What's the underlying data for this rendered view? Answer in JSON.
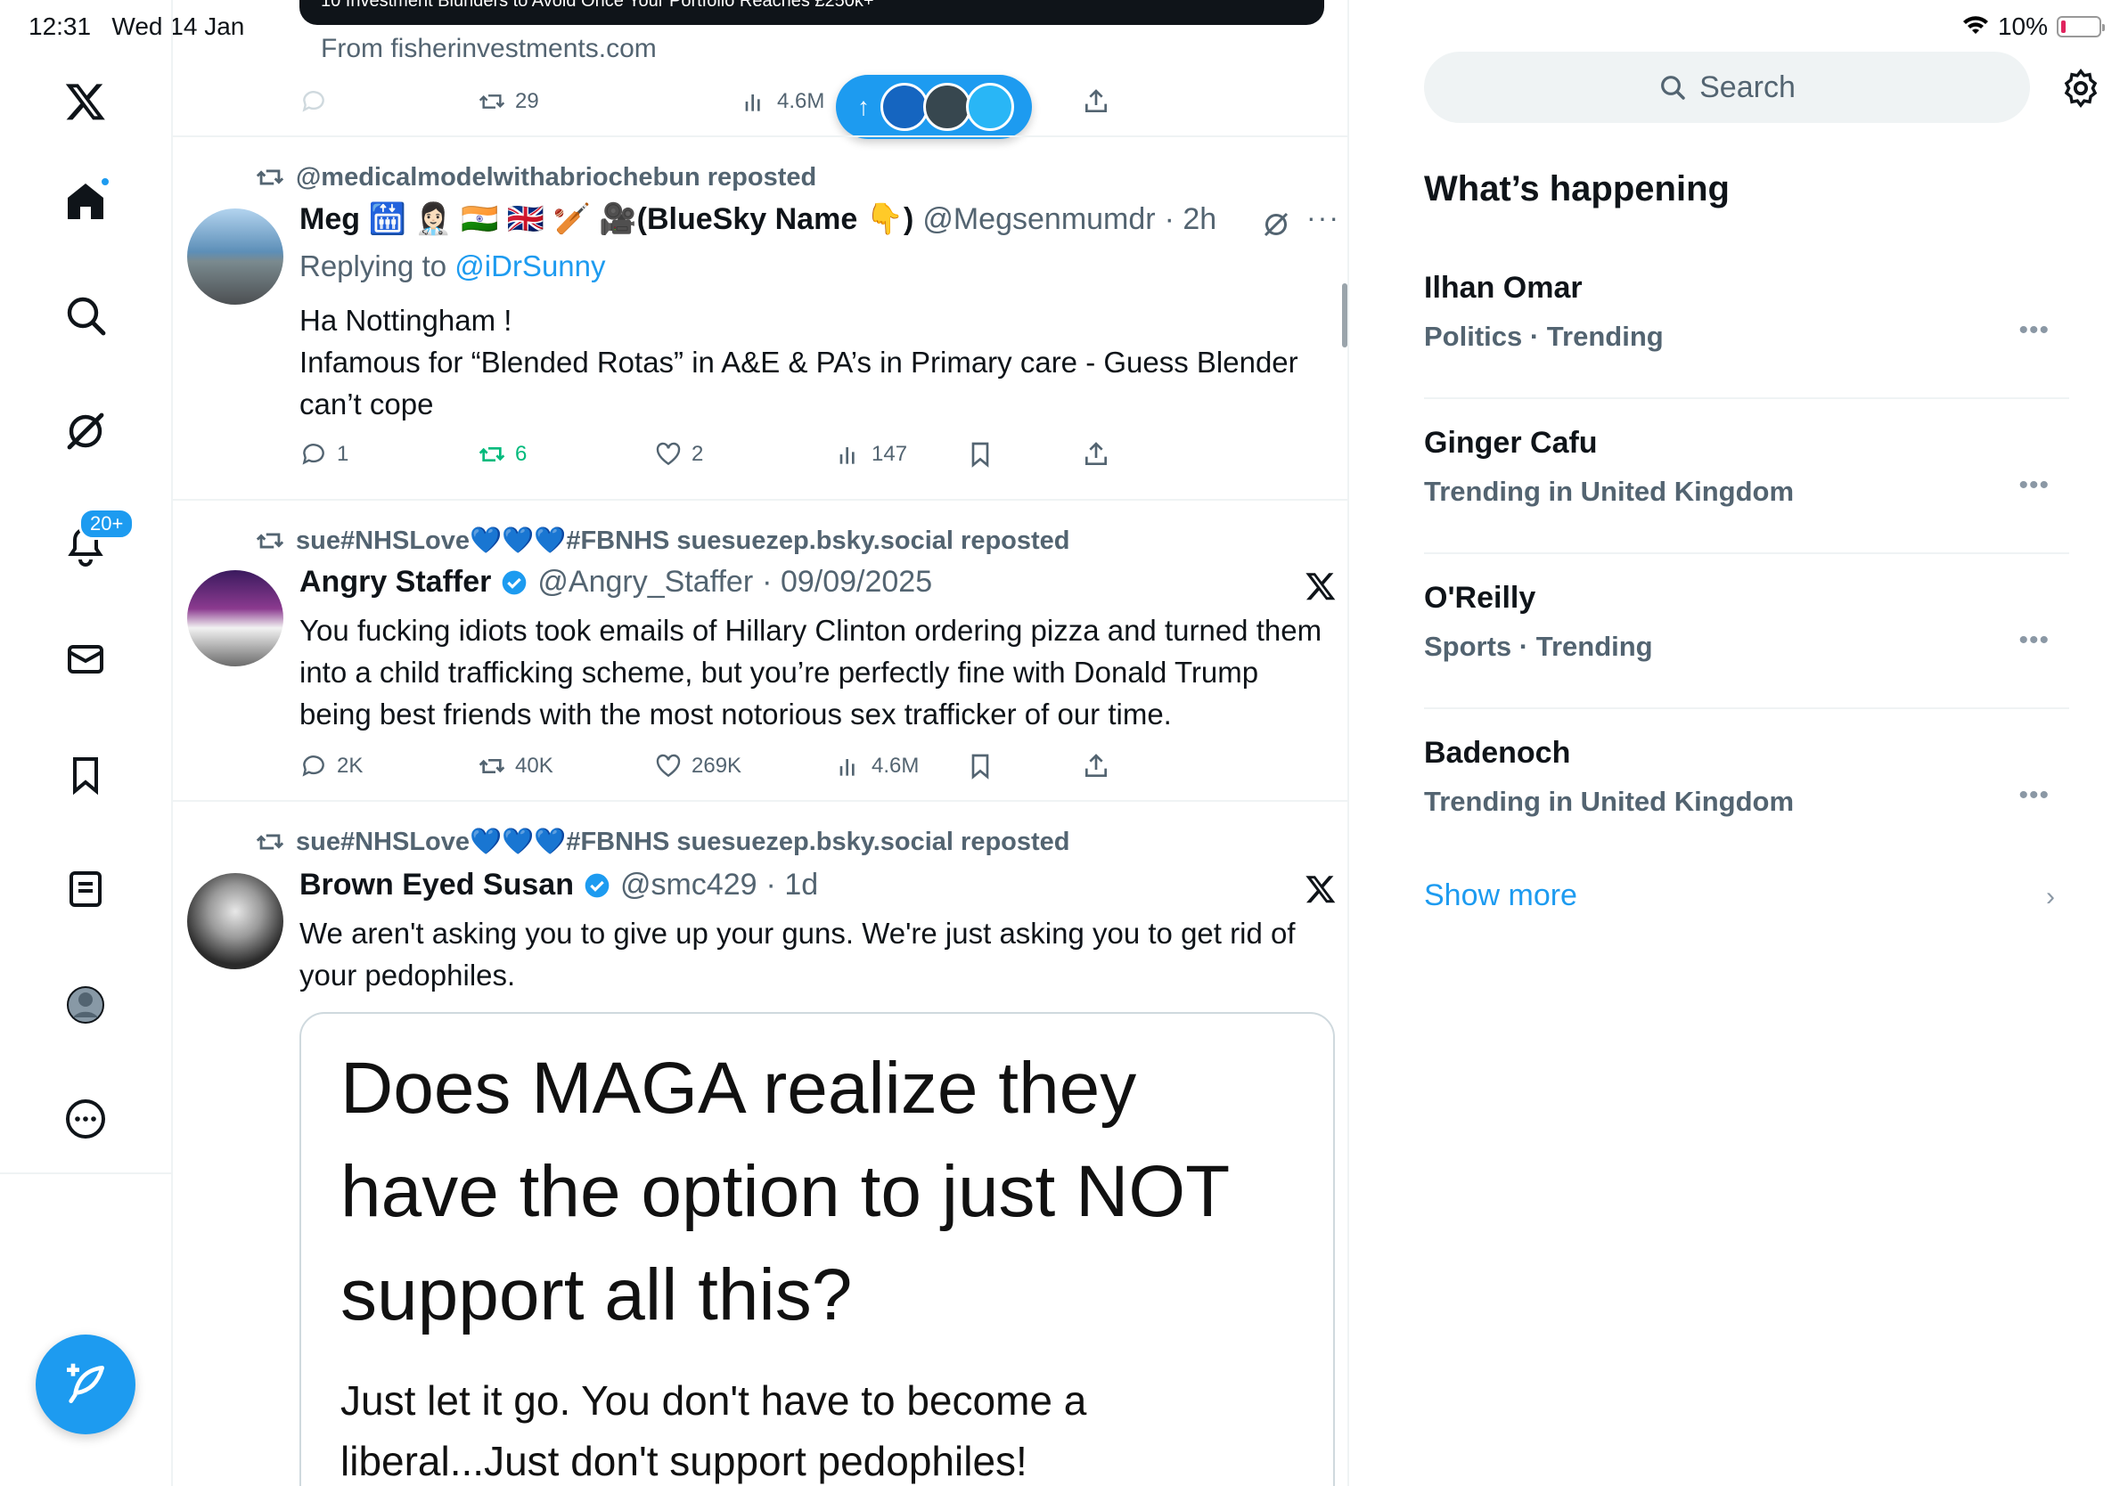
{
  "status_bar": {
    "time": "12:31",
    "date": "Wed 14 Jan",
    "battery": "10%"
  },
  "nav": {
    "notifications_badge": "20+"
  },
  "ad": {
    "banner_text": "10 Investment Blunders to Avoid Once Your Portfolio Reaches £250k+",
    "from": "From fisherinvestments.com",
    "reposts": "29",
    "views": "4.6M"
  },
  "tweets": [
    {
      "repost_by": "@medicalmodelwithabriochebun reposted",
      "name": "Meg 🛗 👩🏻‍⚕️ 🇮🇳 🇬🇧 🏏 🎥(BlueSky Name 👇)",
      "handle": "@Megsenmumdr",
      "time": "· 2h",
      "reply_label": "Replying to",
      "reply_to": "@iDrSunny",
      "text_lines": [
        "Ha Nottingham !",
        "Infamous for “Blended Rotas” in A&E & PA’s in Primary care - Guess Blender can’t cope"
      ],
      "replies": "1",
      "reposts": "6",
      "likes": "2",
      "views": "147"
    },
    {
      "repost_by": "sue#NHSLove💙💙💙#FBNHS suesuezep.bsky.social reposted",
      "name": "Angry Staffer",
      "handle": "@Angry_Staffer",
      "time": "· 09/09/2025",
      "text": "You fucking idiots took emails of Hillary Clinton ordering pizza and turned them into a child trafficking scheme, but you’re perfectly fine with Donald Trump being best friends with the most notorious sex trafficker of our time.",
      "replies": "2K",
      "reposts": "40K",
      "likes": "269K",
      "views": "4.6M"
    },
    {
      "repost_by": "sue#NHSLove💙💙💙#FBNHS suesuezep.bsky.social reposted",
      "name": "Brown Eyed Susan",
      "handle": "@smc429",
      "time": "· 1d",
      "text": "We aren't asking you to give up your guns. We're just asking you to get rid of your pedophiles.",
      "media_headline": "Does MAGA realize they have the option to just NOT support all this?",
      "media_subtext": "Just let it go. You don't have to become a liberal...Just don't support pedophiles!"
    }
  ],
  "search": {
    "placeholder": "Search"
  },
  "whats_happening": {
    "title": "What’s happening",
    "trends": [
      {
        "name": "Ilhan Omar",
        "meta": "Politics · Trending"
      },
      {
        "name": "Ginger Cafu",
        "meta": "Trending in United Kingdom"
      },
      {
        "name": "O'Reilly",
        "meta": "Sports · Trending"
      },
      {
        "name": "Badenoch",
        "meta": "Trending in United Kingdom"
      }
    ],
    "show_more": "Show more"
  },
  "colors": {
    "accent": "#1d9bf0",
    "text": "#0f1419",
    "muted": "#536471",
    "repost_green": "#00ba7c"
  }
}
